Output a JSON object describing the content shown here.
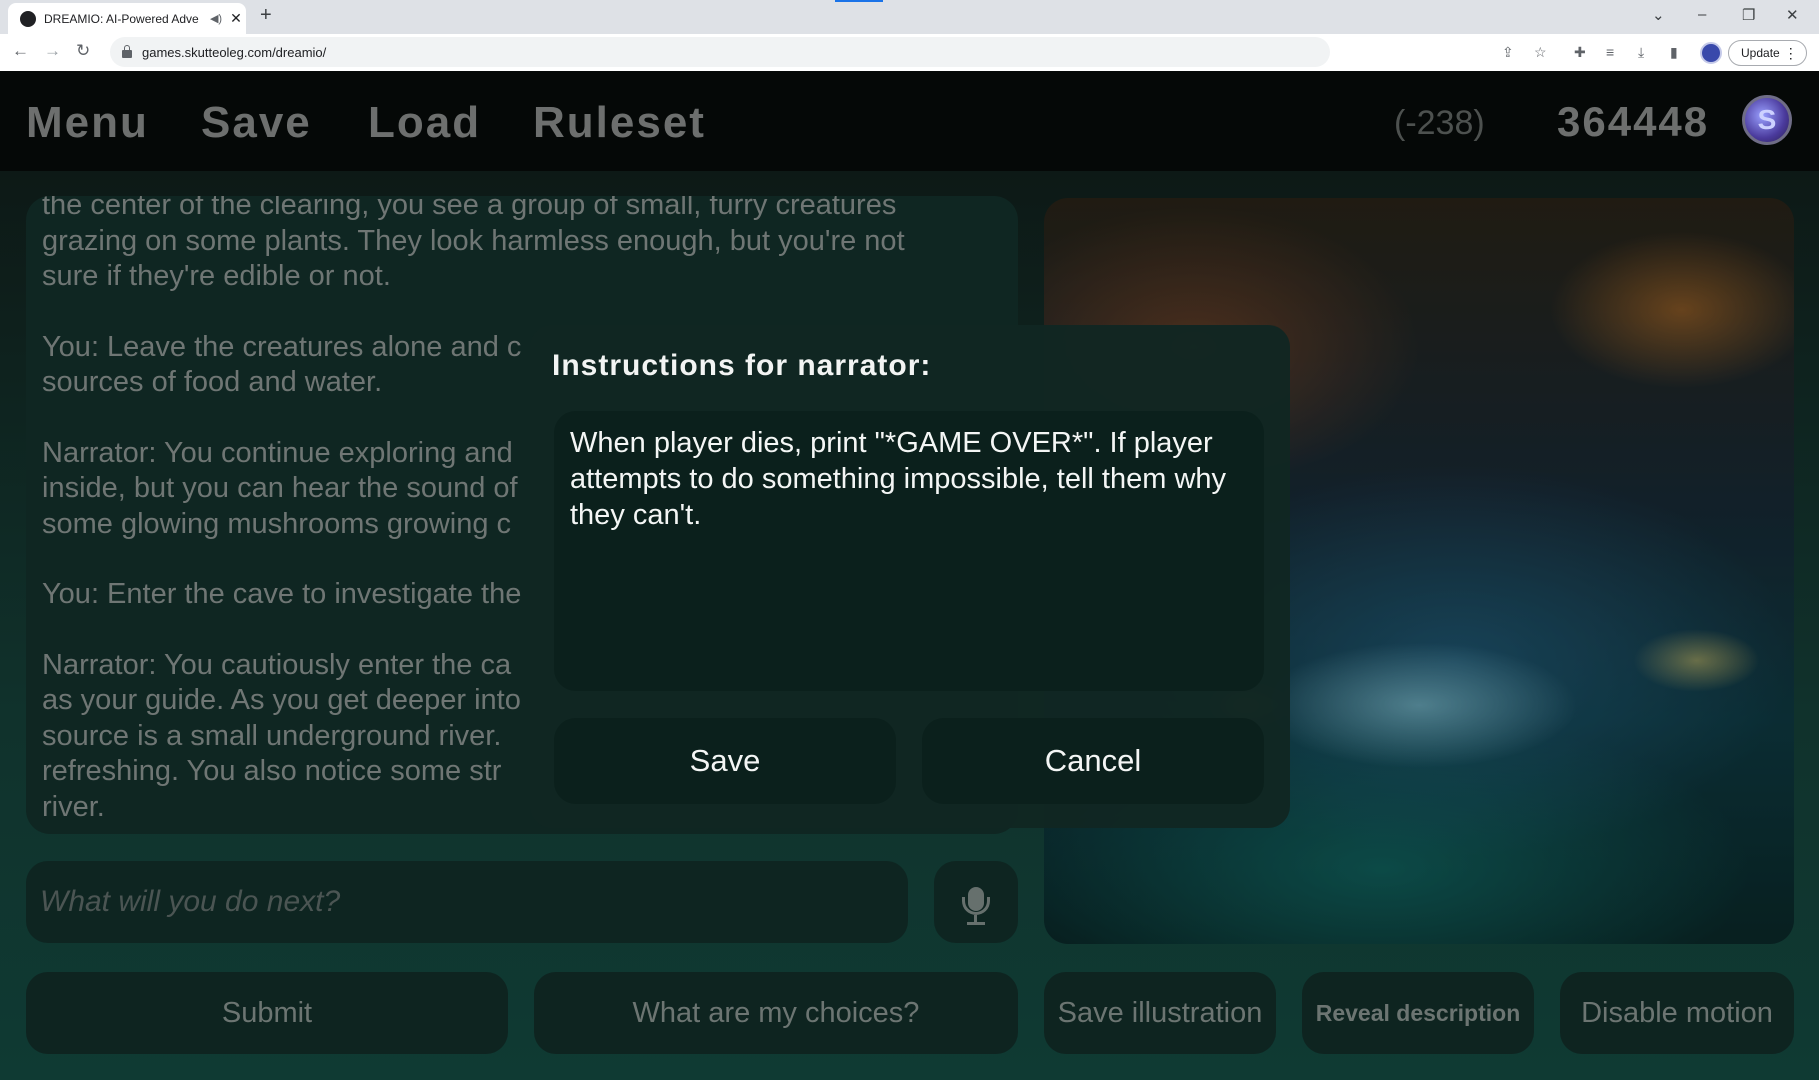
{
  "browser": {
    "tab_title": "DREAMIO: AI-Powered Adve",
    "url": "games.skutteoleg.com/dreamio/",
    "update_label": "Update"
  },
  "header": {
    "menu_label": "Menu",
    "save_label": "Save",
    "load_label": "Load",
    "ruleset_label": "Ruleset",
    "credit_delta": "(-238)",
    "credit_total": "364448"
  },
  "story": {
    "paragraphs": [
      "the center of the clearing, you see a group of small, furry creatures grazing on some plants. They look harmless enough, but you're not sure if they're edible or not.",
      "You: Leave the creatures alone and c\nsources of food and water.",
      "Narrator: You continue exploring and\ninside, but you can hear the sound of\nsome glowing mushrooms growing c",
      "You: Enter the cave to investigate the",
      "Narrator: You cautiously enter the ca\nas your guide. As you get deeper into\nsource is a small underground river.\nrefreshing. You also notice some str\nriver."
    ]
  },
  "input": {
    "placeholder": "What will you do next?"
  },
  "buttons": {
    "submit": "Submit",
    "choices": "What are my choices?",
    "save_illustration": "Save illustration",
    "reveal_description": "Reveal description",
    "disable_motion": "Disable motion"
  },
  "modal": {
    "title": "Instructions for narrator:",
    "text": "When player dies, print \"*GAME OVER*\". If player attempts to do something impossible, tell them why they can't.",
    "save_label": "Save",
    "cancel_label": "Cancel"
  }
}
